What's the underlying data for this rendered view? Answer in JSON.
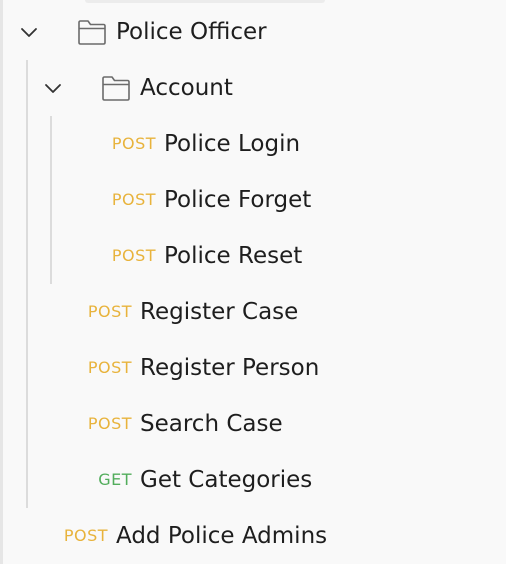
{
  "colors": {
    "post_method": "#e8b33c",
    "get_method": "#52ad5c",
    "label_text": "#1e1e1e",
    "icon_stroke": "#6b6b6b",
    "guide_line": "#dcdcdc",
    "background": "#f9f9f9"
  },
  "collection": {
    "folder": {
      "label": "Police Officer",
      "icon": "folder-icon",
      "expanded": true,
      "subfolder": {
        "label": "Account",
        "icon": "folder-icon",
        "expanded": true,
        "requests": [
          {
            "method": "POST",
            "label": "Police Login"
          },
          {
            "method": "POST",
            "label": "Police Forget"
          },
          {
            "method": "POST",
            "label": "Police Reset"
          }
        ]
      },
      "requests": [
        {
          "method": "POST",
          "label": "Register Case"
        },
        {
          "method": "POST",
          "label": "Register Person"
        },
        {
          "method": "POST",
          "label": "Search Case"
        },
        {
          "method": "GET",
          "label": "Get Categories"
        }
      ]
    },
    "root_requests": [
      {
        "method": "POST",
        "label": "Add Police Admins"
      }
    ]
  }
}
